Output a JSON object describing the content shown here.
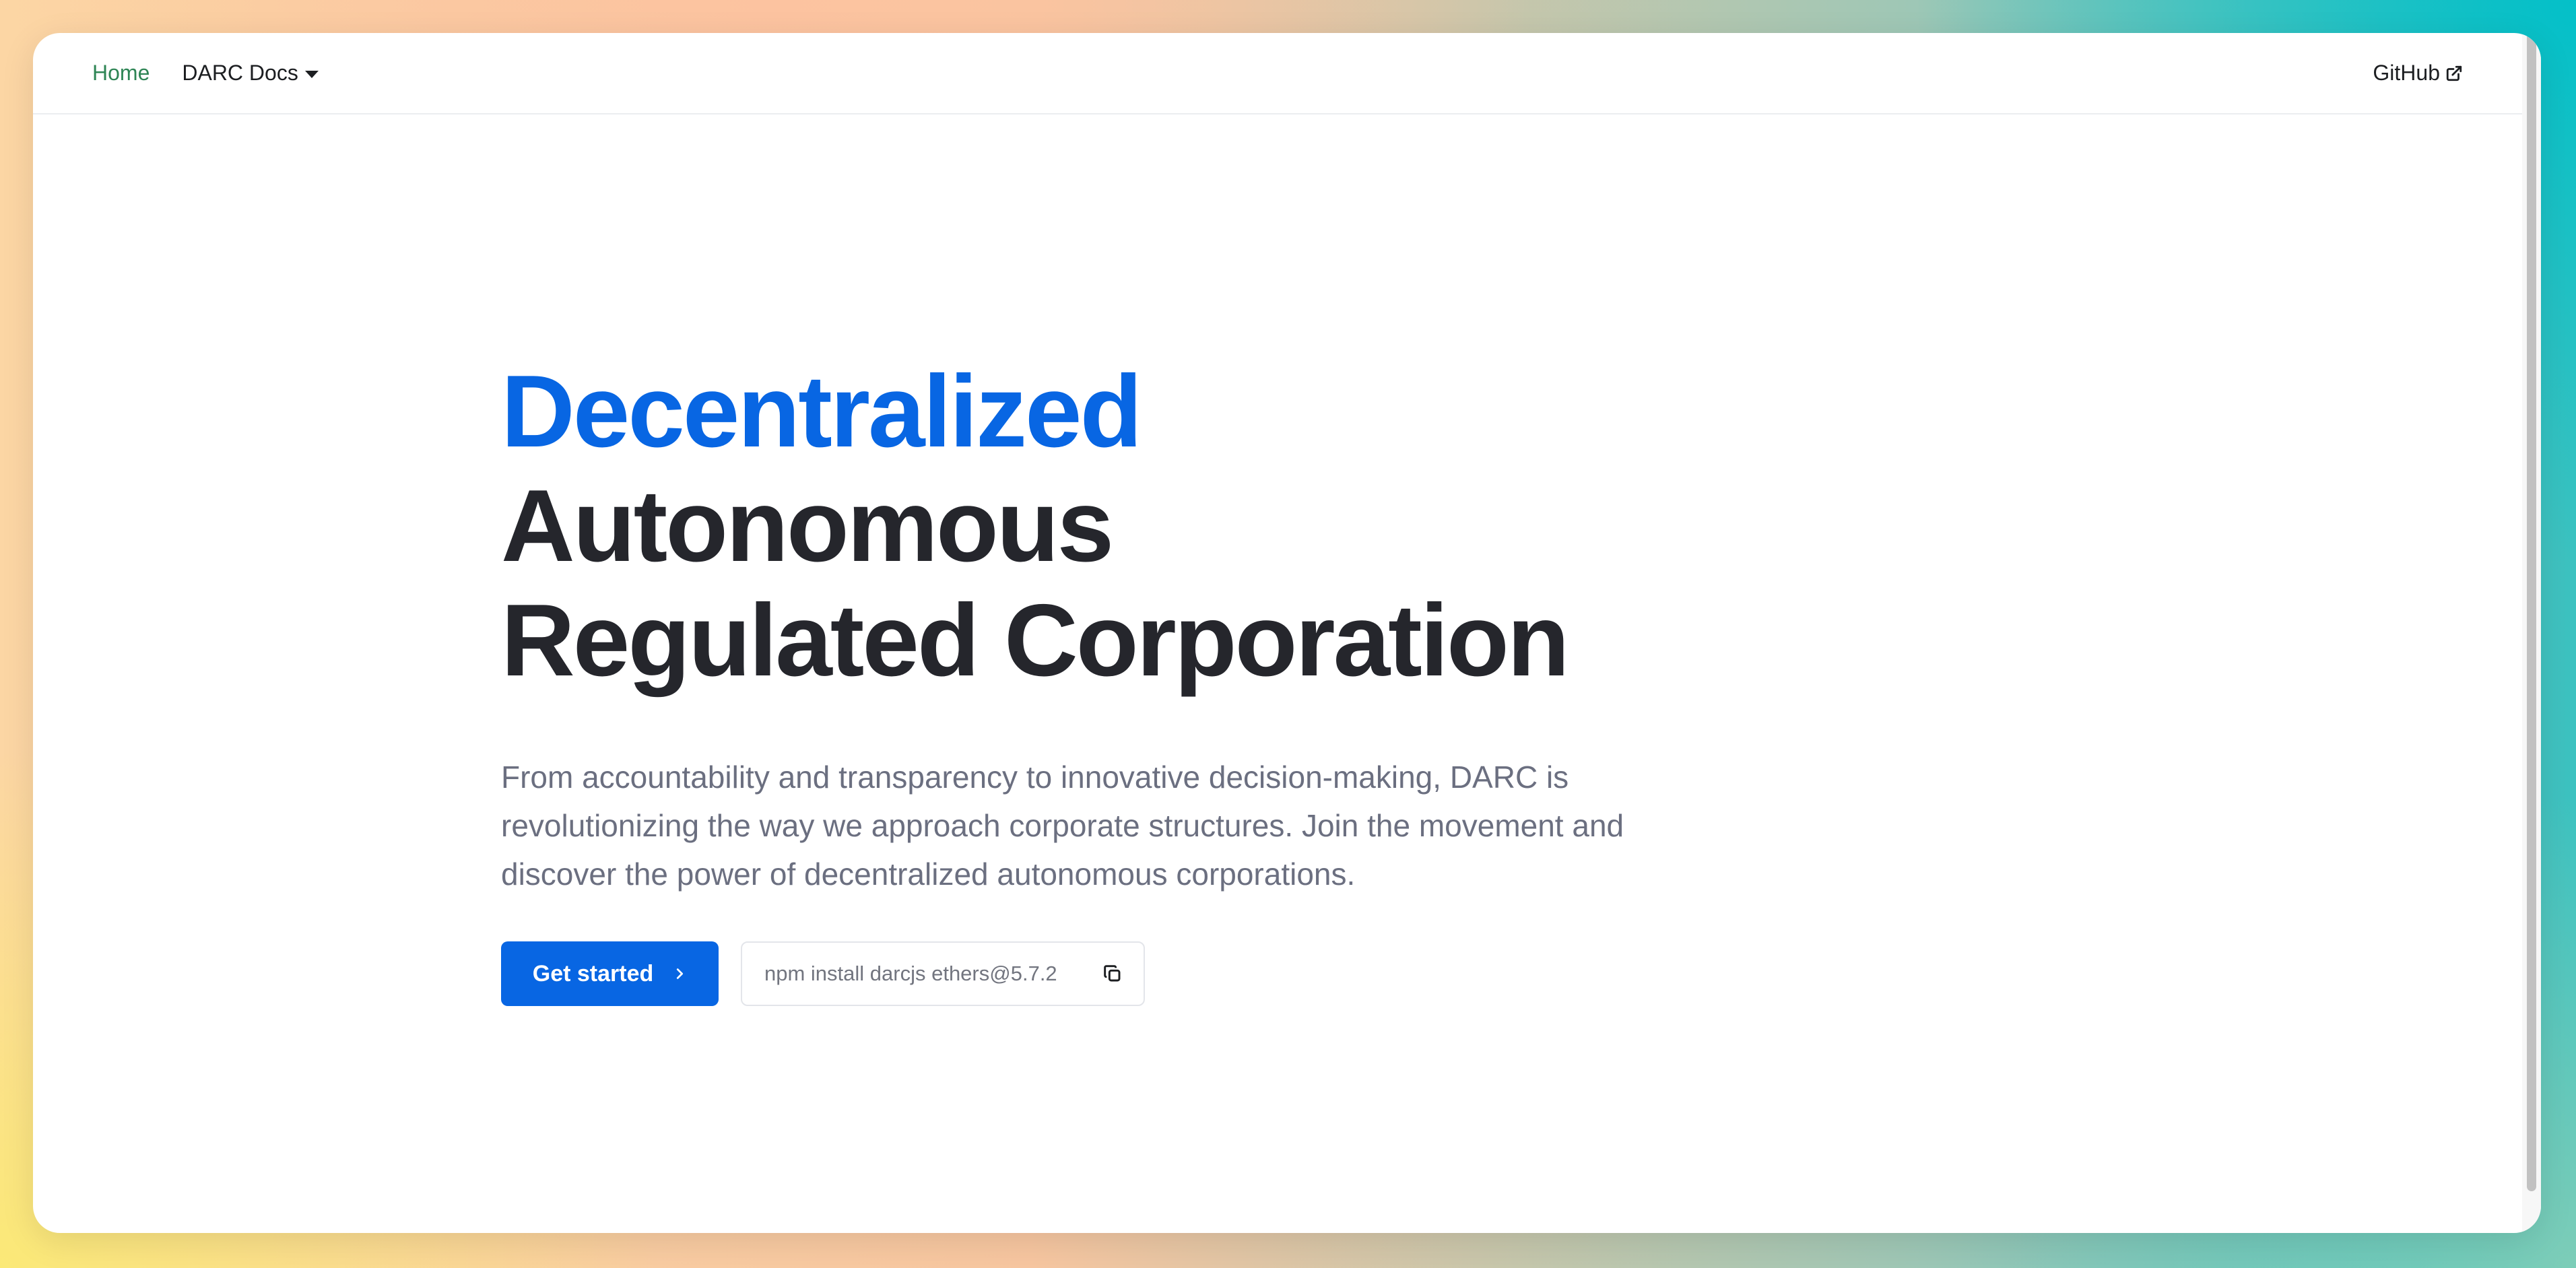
{
  "nav": {
    "home": "Home",
    "docs": "DARC Docs",
    "github": "GitHub"
  },
  "hero": {
    "title_accent": "Decentralized",
    "title_line2": "Autonomous",
    "title_line3": "Regulated Corporation",
    "subtitle": "From accountability and transparency to innovative decision-making, DARC is revolutionizing the way we approach corporate structures. Join the movement and discover the power of decentralized autonomous corporations.",
    "cta_label": "Get started",
    "install_command": "npm install darcjs ethers@5.7.2"
  },
  "icons": {
    "docs_dropdown": "caret-down-icon",
    "github_external": "external-link-icon",
    "cta": "chevron-right-icon",
    "copy": "copy-icon"
  },
  "colors": {
    "accent": "#0866e3",
    "active_nav": "#2e8555",
    "heading": "#25262c",
    "subtitle": "#6b6f80"
  }
}
